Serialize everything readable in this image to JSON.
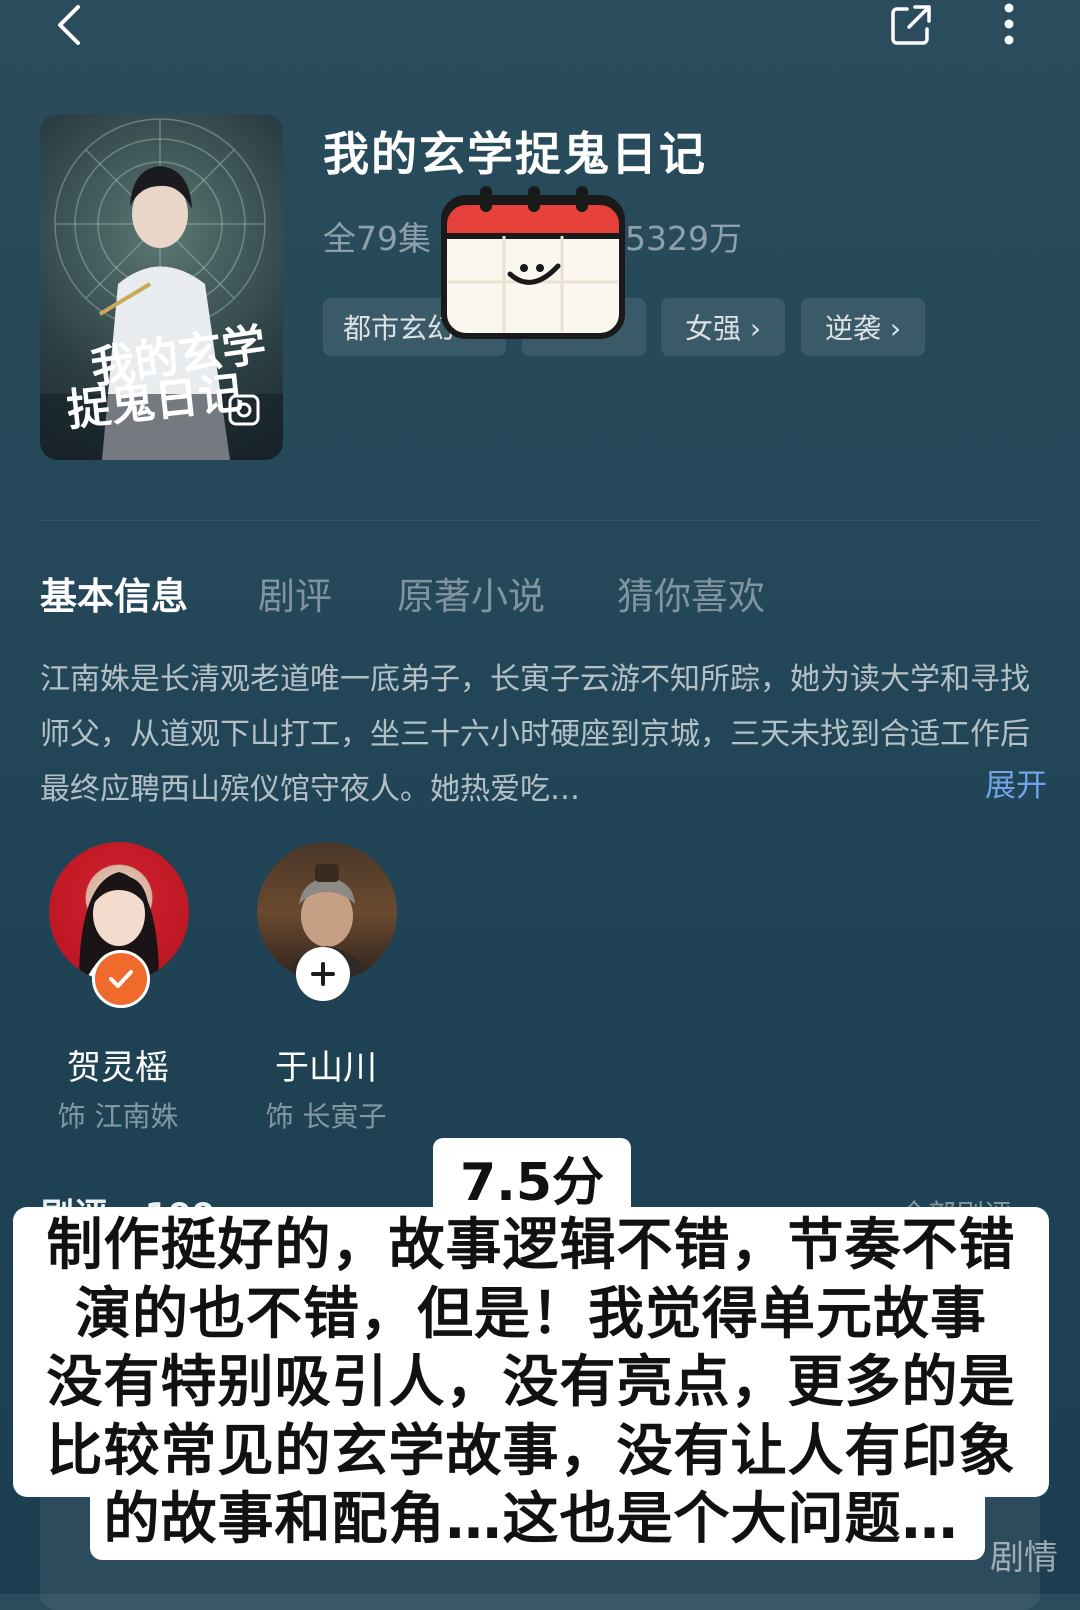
{
  "header": {
    "back_icon": "chevron-left-icon",
    "share_icon": "share-icon",
    "more_icon": "more-vertical-icon"
  },
  "drama": {
    "title": "我的玄学捉鬼日记",
    "episodes": "全79集",
    "views": "5329万",
    "tags": [
      "都市玄幻",
      "女强 ›",
      "逆袭 ›"
    ],
    "poster_title_line1": "我的玄学",
    "poster_title_line2": "捉鬼日记"
  },
  "tabs": [
    "基本信息",
    "剧评",
    "原著小说",
    "猜你喜欢"
  ],
  "synopsis": {
    "text": "江南姝是长清观老道唯一底弟子，长寅子云游不知所踪，她为读大学和寻找师父，从道观下山打工，坐三十六小时硬座到京城，三天未找到合适工作后最终应聘西山殡仪馆守夜人。她热爱吃…",
    "expand_label": "展开"
  },
  "cast": [
    {
      "name": "贺灵榣",
      "role": "饰 江南姝",
      "badge": "check-icon",
      "badge_color": "#f06a2c"
    },
    {
      "name": "于山川",
      "role": "饰 长寅子",
      "badge": "plus-icon",
      "badge_color": "#ffffff"
    }
  ],
  "reviews": {
    "heading": "剧评 · 199",
    "all_label": "全部剧评",
    "peek_label": "剧情"
  },
  "overlay": {
    "score": "7.5分",
    "lines": [
      "制作挺好的，故事逻辑不错，节奏不错",
      "演的也不错，但是！我觉得单元故事",
      "没有特别吸引人，没有亮点，更多的是",
      "比较常见的玄学故事，没有让人有印象",
      "的故事和配角…这也是个大问题…"
    ]
  },
  "sticker": "calendar-smile-icon",
  "colors": {
    "accent_link": "#6fa4e6",
    "check_badge": "#f06a2c",
    "calendar_top": "#e5413a",
    "background": "#254a5b"
  }
}
